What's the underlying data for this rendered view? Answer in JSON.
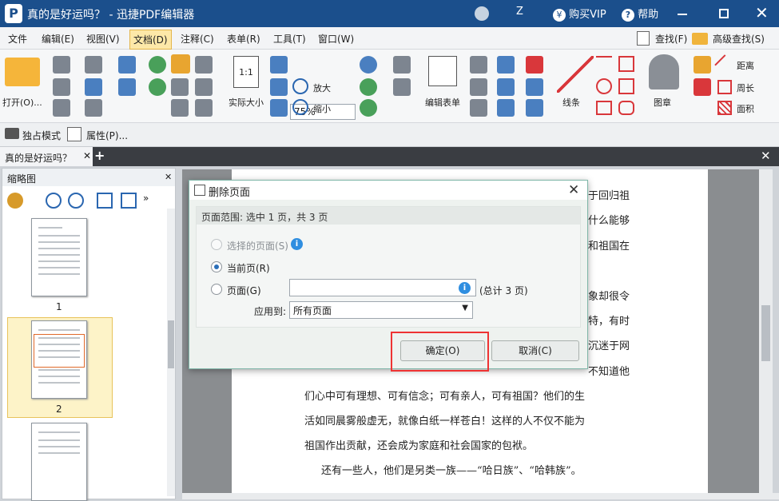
{
  "window": {
    "title": "真的是好运吗？ - 迅捷PDF编辑器",
    "user": "Z",
    "buy_vip": "购买VIP",
    "help": "帮助"
  },
  "menu": {
    "items": [
      "文件",
      "编辑(E)",
      "视图(V)",
      "文档(D)",
      "注释(C)",
      "表单(R)",
      "工具(T)",
      "窗口(W)"
    ],
    "find": "查找(F)",
    "advanced_find": "高级查找(S)"
  },
  "toolbar": {
    "open": "打开(O)...",
    "actual_size": "实际大小",
    "zoom": "75%",
    "zoom_in": "放大",
    "zoom_out": "缩小",
    "edit_form": "编辑表单",
    "line": "线条",
    "stamp": "图章",
    "distance": "距离",
    "perimeter": "周长",
    "area": "面积",
    "exclusive_mode": "独占模式",
    "properties": "属性(P)..."
  },
  "tabs": {
    "doc_tab": "真的是好运吗？"
  },
  "thumbnails": {
    "title": "缩略图",
    "pages": [
      "1",
      "2"
    ]
  },
  "document": {
    "lines": [
      "于回归祖",
      "什么能够",
      "和祖国在",
      "象却很令",
      "特，有时",
      "沉迷于网",
      "不知道他",
      "们心中可有理想、可有信念；可有亲人，可有祖国？他们的生",
      "活如同晨雾般虚无，就像白纸一样苍白！这样的人不仅不能为",
      "祖国作出贡献，还会成为家庭和社会国家的包袱。",
      "还有一些人，他们是另类一族——“哈日族”、“哈韩族”。"
    ]
  },
  "dialog": {
    "title": "删除页面",
    "range_header": "页面范围: 选中 1 页，共 3 页",
    "option_selected": "选择的页面(S)",
    "option_current": "当前页(R)",
    "option_pages": "页面(G)",
    "total": "(总计 3 页)",
    "apply_to_label": "应用到:",
    "apply_to_value": "所有页面",
    "ok": "确定(O)",
    "cancel": "取消(C)",
    "pages_input_value": ""
  },
  "colors": {
    "titlebar": "#1b4f8c",
    "highlight": "#ee3333"
  }
}
